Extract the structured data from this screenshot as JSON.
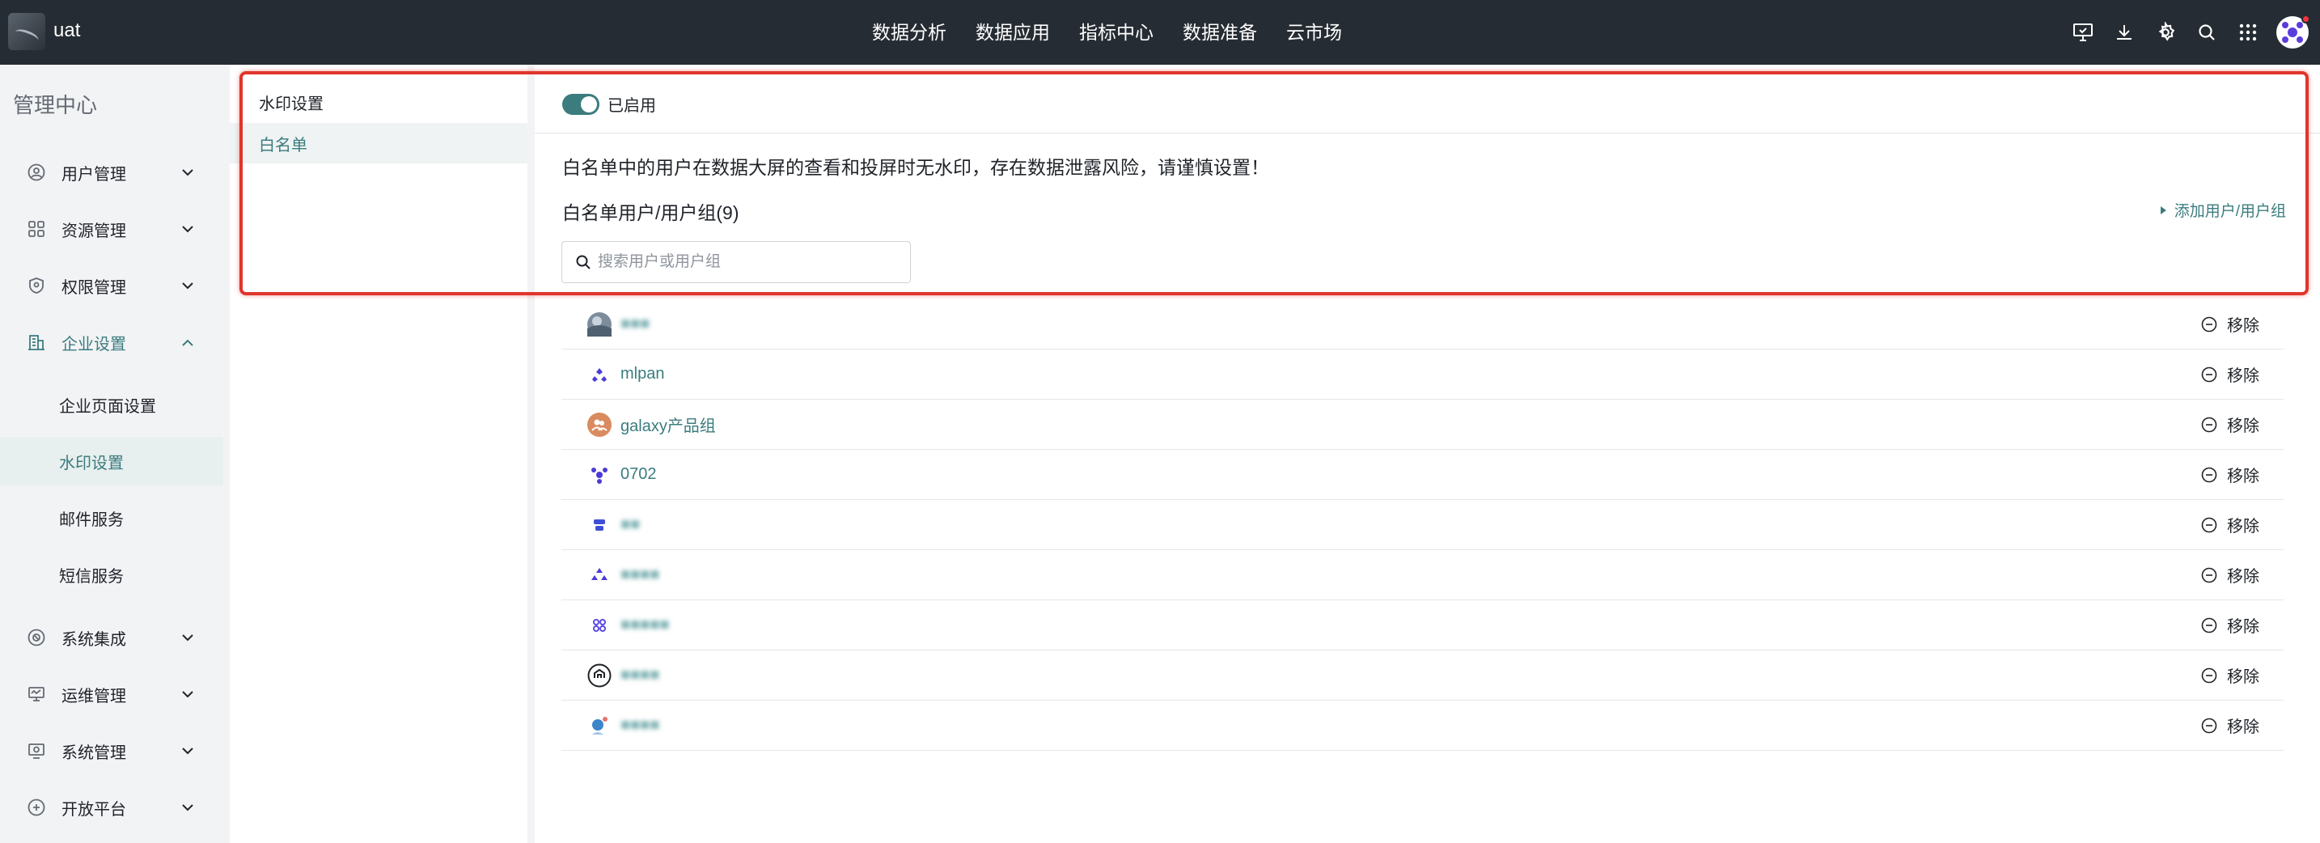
{
  "app": {
    "name": "uat"
  },
  "topnav": [
    "数据分析",
    "数据应用",
    "指标中心",
    "数据准备",
    "云市场"
  ],
  "sidebar": {
    "title": "管理中心",
    "items": [
      {
        "label": "用户管理",
        "icon": "user-icon"
      },
      {
        "label": "资源管理",
        "icon": "grid-icon"
      },
      {
        "label": "权限管理",
        "icon": "shield-icon"
      },
      {
        "label": "企业设置",
        "icon": "building-icon"
      },
      {
        "label": "系统集成",
        "icon": "integration-icon"
      },
      {
        "label": "运维管理",
        "icon": "monitor-icon"
      },
      {
        "label": "系统管理",
        "icon": "system-icon"
      },
      {
        "label": "开放平台",
        "icon": "platform-icon"
      }
    ],
    "subitems": [
      "企业页面设置",
      "水印设置",
      "邮件服务",
      "短信服务"
    ]
  },
  "subpanel": {
    "items": [
      "水印设置",
      "白名单"
    ]
  },
  "main": {
    "toggle_label": "已启用",
    "notice": "白名单中的用户在数据大屏的查看和投屏时无水印，存在数据泄露风险，请谨慎设置！",
    "list_title": "白名单用户/用户组(9)",
    "add_label": "添加用户/用户组",
    "search_placeholder": "搜索用户或用户组",
    "remove_label": "移除",
    "rows": [
      {
        "name": "■■■",
        "color": "#6b7d8f",
        "blurred": true
      },
      {
        "name": "mlpan",
        "color": "#ffffff",
        "blurred": false
      },
      {
        "name": "galaxy产品组",
        "color": "#d98b5f",
        "blurred": false
      },
      {
        "name": "0702",
        "color": "#ffffff",
        "blurred": false
      },
      {
        "name": "■■",
        "color": "#ffffff",
        "blurred": true
      },
      {
        "name": "■■■■",
        "color": "#ffffff",
        "blurred": true
      },
      {
        "name": "■■■■■",
        "color": "#ffffff",
        "blurred": true
      },
      {
        "name": "■■■■",
        "color": "#ffffff",
        "blurred": true
      },
      {
        "name": "■■■■",
        "color": "#ffffff",
        "blurred": true
      }
    ]
  }
}
